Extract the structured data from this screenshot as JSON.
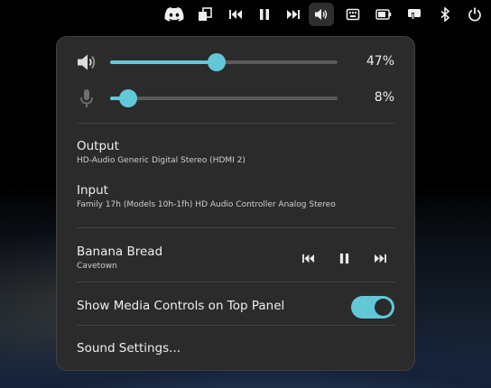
{
  "volume": {
    "output_percent_label": "47%",
    "output_level": 0.47,
    "input_percent_label": "8%",
    "input_level": 0.08
  },
  "devices": {
    "output_title": "Output",
    "output_device": "HD-Audio Generic Digital Stereo (HDMI 2)",
    "input_title": "Input",
    "input_device": "Family 17h (Models 10h-1fh) HD Audio Controller Analog Stereo"
  },
  "media": {
    "title": "Banana Bread",
    "artist": "Cavetown"
  },
  "toggle": {
    "label": "Show Media Controls on Top Panel",
    "on": true
  },
  "settings_label": "Sound Settings...",
  "colors": {
    "accent": "#62c8d8",
    "menu_bg": "#2b2b2b",
    "panel_bg": "#000000"
  },
  "panel_icons": [
    "discord-icon",
    "clipboard-icon",
    "previous-track-icon",
    "pause-icon",
    "next-track-icon",
    "volume-icon",
    "keyboard-icon",
    "battery-icon",
    "kdeconnect-icon",
    "bluetooth-icon",
    "power-icon"
  ]
}
